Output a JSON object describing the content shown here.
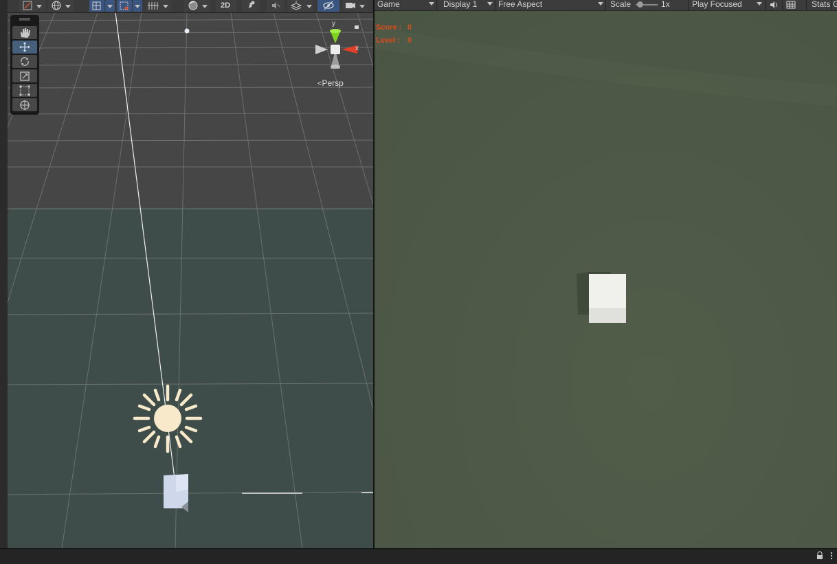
{
  "scene": {
    "toolbar": {
      "mode_2d_label": "2D"
    },
    "gizmo": {
      "axis_y_label": "y",
      "axis_x_label": "x",
      "projection_label": "Persp",
      "projection_icon": "chevron-left-icon",
      "lock_icon": "lock-icon"
    },
    "tools": [
      "hand-tool-icon",
      "move-tool-icon",
      "rotate-tool-icon",
      "scale-tool-icon",
      "rect-tool-icon",
      "transform-tool-icon"
    ],
    "active_tool": "move-tool-icon"
  },
  "game": {
    "toolbar": {
      "tab_label": "Game",
      "display_label": "Display 1",
      "aspect_label": "Free Aspect",
      "scale_label": "Scale",
      "scale_value": "1x",
      "play_mode_label": "Play Focused",
      "stats_label": "Stats",
      "gizmos_label": "G"
    },
    "hud": {
      "score_label": "Score :",
      "score_value": "0",
      "level_label": "Level :",
      "level_value": "0"
    }
  },
  "colors": {
    "hud_text": "#e04a1a",
    "game_background": "#4f5a48",
    "scene_ground": "#3e4d49",
    "scene_sky": "#464646",
    "active_tool": "#46607c",
    "axis_y": "#7ed321",
    "axis_x": "#e0402a"
  }
}
